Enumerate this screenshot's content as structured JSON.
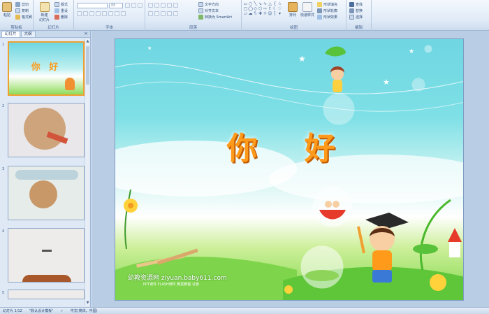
{
  "ribbon": {
    "clipboard": {
      "paste": "粘贴",
      "cut": "剪切",
      "copy": "复制",
      "format_painter": "格式刷",
      "label": "剪贴板"
    },
    "slides": {
      "new_slide": "新建\n幻灯片",
      "layout": "版式",
      "reset": "重设",
      "delete": "删除",
      "label": "幻灯片"
    },
    "font": {
      "font_value": "",
      "size_value": "88",
      "label": "字体"
    },
    "paragraph": {
      "text_direction": "文字方向",
      "align_text": "对齐文本",
      "smartart": "转换为 SmartArt",
      "label": "段落"
    },
    "drawing": {
      "arrange": "排列",
      "quick_styles": "快速样式",
      "shape_fill": "形状填充",
      "shape_outline": "形状轮廓",
      "shape_effects": "形状效果",
      "label": "绘图"
    },
    "editing": {
      "find": "查找",
      "replace": "替换",
      "select": "选择",
      "label": "编辑"
    }
  },
  "panel": {
    "tabs": [
      "幻灯片",
      "大纲"
    ],
    "close_glyph": "×",
    "thumbnails": [
      {
        "num": "1",
        "title": "你 好"
      },
      {
        "num": "2"
      },
      {
        "num": "3"
      },
      {
        "num": "4"
      },
      {
        "num": "5"
      }
    ]
  },
  "slide": {
    "title": "你 好",
    "site": "幼教资源网 ziyuan.baby611.com",
    "sub": "PPT课件 FLASH课件 教案教程 试卷"
  },
  "status": {
    "slide_info": "幻灯片 1/12",
    "theme": "\"默认设计模板\"",
    "language": "中文(简体，中国)"
  },
  "colors": {
    "accent": "#f0a030",
    "title_orange": "#ff9a1a",
    "ribbon_bg": "#dfeaf7"
  }
}
